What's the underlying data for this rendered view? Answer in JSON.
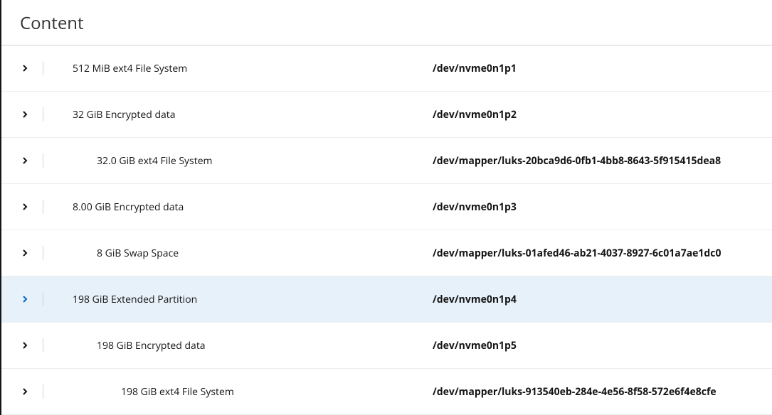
{
  "section": {
    "title": "Content"
  },
  "rows": [
    {
      "indent": 0,
      "description": "512 MiB ext4 File System",
      "path": "/dev/nvme0n1p1",
      "hovered": false
    },
    {
      "indent": 0,
      "description": "32 GiB Encrypted data",
      "path": "/dev/nvme0n1p2",
      "hovered": false
    },
    {
      "indent": 1,
      "description": "32.0 GiB ext4 File System",
      "path": "/dev/mapper/luks-20bca9d6-0fb1-4bb8-8643-5f915415dea8",
      "hovered": false
    },
    {
      "indent": 0,
      "description": "8.00 GiB Encrypted data",
      "path": "/dev/nvme0n1p3",
      "hovered": false
    },
    {
      "indent": 1,
      "description": "8 GiB Swap Space",
      "path": "/dev/mapper/luks-01afed46-ab21-4037-8927-6c01a7ae1dc0",
      "hovered": false
    },
    {
      "indent": 0,
      "description": "198 GiB Extended Partition",
      "path": "/dev/nvme0n1p4",
      "hovered": true
    },
    {
      "indent": 1,
      "description": "198 GiB Encrypted data",
      "path": "/dev/nvme0n1p5",
      "hovered": false
    },
    {
      "indent": 2,
      "description": "198 GiB ext4 File System",
      "path": "/dev/mapper/luks-913540eb-284e-4e56-8f58-572e6f4e8cfe",
      "hovered": false
    }
  ]
}
